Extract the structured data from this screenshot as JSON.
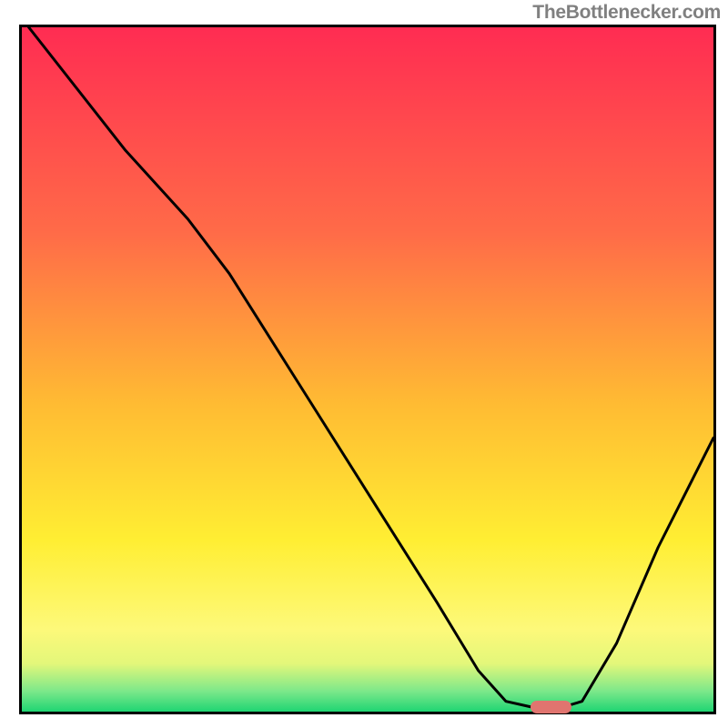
{
  "watermark": "TheBottlenecker.com",
  "chart_data": {
    "type": "area",
    "title": "",
    "xlabel": "",
    "ylabel": "",
    "xlim": [
      0,
      100
    ],
    "ylim": [
      0,
      100
    ],
    "gradient_stops": [
      {
        "pos": 0,
        "color": "#ff2c52"
      },
      {
        "pos": 30,
        "color": "#ff6b48"
      },
      {
        "pos": 55,
        "color": "#ffbb33"
      },
      {
        "pos": 75,
        "color": "#ffee33"
      },
      {
        "pos": 88,
        "color": "#fdf97a"
      },
      {
        "pos": 93,
        "color": "#e3f77a"
      },
      {
        "pos": 97,
        "color": "#7de88a"
      },
      {
        "pos": 100,
        "color": "#1fd573"
      }
    ],
    "curve": [
      {
        "x": 1,
        "y": 100
      },
      {
        "x": 15,
        "y": 82
      },
      {
        "x": 24,
        "y": 72
      },
      {
        "x": 30,
        "y": 64
      },
      {
        "x": 40,
        "y": 48
      },
      {
        "x": 50,
        "y": 32
      },
      {
        "x": 60,
        "y": 16
      },
      {
        "x": 66,
        "y": 6
      },
      {
        "x": 70,
        "y": 1.5
      },
      {
        "x": 74,
        "y": 0.6
      },
      {
        "x": 78,
        "y": 0.6
      },
      {
        "x": 81,
        "y": 1.5
      },
      {
        "x": 86,
        "y": 10
      },
      {
        "x": 92,
        "y": 24
      },
      {
        "x": 100,
        "y": 40
      }
    ],
    "marker": {
      "x_start": 73.5,
      "x_end": 79.5,
      "y": 0.6
    }
  }
}
